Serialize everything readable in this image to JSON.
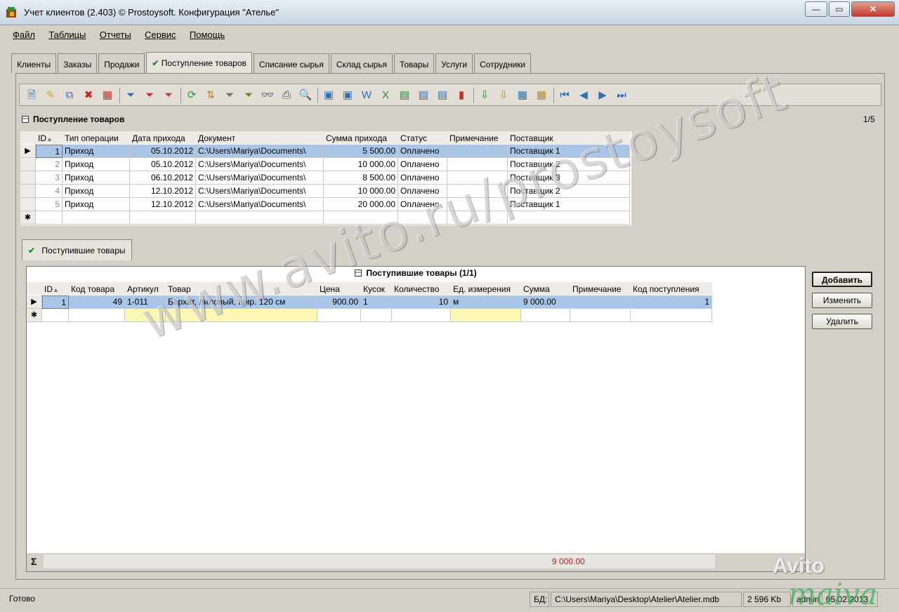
{
  "window": {
    "title": "Учет клиентов (2.403) © Prostoysoft. Конфигурация \"Ателье\"",
    "btn_min": "—",
    "btn_max": "▭",
    "btn_close": "✕"
  },
  "menu": [
    "Файл",
    "Таблицы",
    "Отчеты",
    "Сервис",
    "Помощь"
  ],
  "tabs": [
    "Клиенты",
    "Заказы",
    "Продажи",
    "Поступление товаров",
    "Списание сырья",
    "Склад сырья",
    "Товары",
    "Услуги",
    "Сотрудники"
  ],
  "active_tab": "Поступление товаров",
  "check_glyph": "✔",
  "toolbar_icons": [
    {
      "name": "new-record-icon",
      "glyph": "🗎",
      "color": "#2f6fb5"
    },
    {
      "name": "edit-pencil-icon",
      "glyph": "✎",
      "color": "#e0a020"
    },
    {
      "name": "copy-record-icon",
      "glyph": "⧉",
      "color": "#2f6fb5"
    },
    {
      "name": "delete-icon",
      "glyph": "✖",
      "color": "#d02020"
    },
    {
      "name": "delete-table-icon",
      "glyph": "▦",
      "color": "#c03030"
    },
    {
      "name": "filter-icon",
      "glyph": "⏷",
      "color": "#2f6fb5"
    },
    {
      "name": "filter-remove-icon",
      "glyph": "⏷",
      "color": "#d03030"
    },
    {
      "name": "filter-clear-icon",
      "glyph": "⏷",
      "color": "#c04040"
    },
    {
      "name": "refresh-icon",
      "glyph": "⟳",
      "color": "#2a9a3a"
    },
    {
      "name": "sort-icon",
      "glyph": "⇅",
      "color": "#b08a20"
    },
    {
      "name": "advanced-filter-icon",
      "glyph": "⏷",
      "color": "#707070"
    },
    {
      "name": "sql-icon",
      "glyph": "⏷",
      "color": "#6a8a20"
    },
    {
      "name": "find-binoculars-icon",
      "glyph": "👓",
      "color": "#202020"
    },
    {
      "name": "print-icon",
      "glyph": "⎙",
      "color": "#404040"
    },
    {
      "name": "print-preview-icon",
      "glyph": "🔍",
      "color": "#2f6fb5"
    },
    {
      "name": "export-icon",
      "glyph": "▣",
      "color": "#2f6fb5"
    },
    {
      "name": "export-2-icon",
      "glyph": "▣",
      "color": "#2f6fb5"
    },
    {
      "name": "export-word-icon",
      "glyph": "W",
      "color": "#2f6fb5"
    },
    {
      "name": "export-excel-icon",
      "glyph": "X",
      "color": "#2a8a2a"
    },
    {
      "name": "export-calc-icon",
      "glyph": "▤",
      "color": "#2a8a2a"
    },
    {
      "name": "export-html-icon",
      "glyph": "▤",
      "color": "#2f6fb5"
    },
    {
      "name": "export-xml-icon",
      "glyph": "▤",
      "color": "#2f6fb5"
    },
    {
      "name": "chart-icon",
      "glyph": "▮",
      "color": "#c03030"
    },
    {
      "name": "import-icon",
      "glyph": "⇩",
      "color": "#2a8a2a"
    },
    {
      "name": "attach-icon",
      "glyph": "⇩",
      "color": "#b08a20"
    },
    {
      "name": "columns-icon",
      "glyph": "▦",
      "color": "#2f6fb5"
    },
    {
      "name": "settings-grid-icon",
      "glyph": "▦",
      "color": "#b08a20"
    },
    {
      "name": "first-record-icon",
      "glyph": "⏮",
      "color": "#2f6fb5"
    },
    {
      "name": "prev-record-icon",
      "glyph": "◀",
      "color": "#2f6fb5"
    },
    {
      "name": "next-record-icon",
      "glyph": "▶",
      "color": "#2f6fb5"
    },
    {
      "name": "last-record-icon",
      "glyph": "⏭",
      "color": "#2f6fb5"
    }
  ],
  "main_section": {
    "title": "Поступление товаров",
    "count": "1/5",
    "columns": [
      "ID",
      "Тип операции",
      "Дата прихода",
      "Документ",
      "Сумма прихода",
      "Статус",
      "Примечание",
      "Поставщик"
    ],
    "sort_mark": "▲",
    "rows": [
      {
        "id": "1",
        "type": "Приход",
        "date": "05.10.2012",
        "doc": "C:\\Users\\Mariya\\Documents\\",
        "sum": "5 500.00",
        "status": "Оплачено",
        "note": "",
        "supplier": "Поставщик 1"
      },
      {
        "id": "2",
        "type": "Приход",
        "date": "05.10.2012",
        "doc": "C:\\Users\\Mariya\\Documents\\",
        "sum": "10 000.00",
        "status": "Оплачено",
        "note": "",
        "supplier": "Поставщик 2"
      },
      {
        "id": "3",
        "type": "Приход",
        "date": "06.10.2012",
        "doc": "C:\\Users\\Mariya\\Documents\\",
        "sum": "8 500.00",
        "status": "Оплачено",
        "note": "",
        "supplier": "Поставщик 3"
      },
      {
        "id": "4",
        "type": "Приход",
        "date": "12.10.2012",
        "doc": "C:\\Users\\Mariya\\Documents\\",
        "sum": "10 000.00",
        "status": "Оплачено",
        "note": "",
        "supplier": "Поставщик 2"
      },
      {
        "id": "5",
        "type": "Приход",
        "date": "12.10.2012",
        "doc": "C:\\Users\\Mariya\\Documents\\",
        "sum": "20 000.00",
        "status": "Оплачено",
        "note": "",
        "supplier": "Поставщик 1"
      }
    ]
  },
  "sub_tab": "Поступившие товары",
  "detail": {
    "title": "Поступившие товары (1/1)",
    "columns": [
      "ID",
      "Код товара",
      "Артикул",
      "Товар",
      "Цена",
      "Кусок",
      "Количество",
      "Ед. измерения",
      "Сумма",
      "Примечание",
      "Код поступления"
    ],
    "rows": [
      {
        "id": "1",
        "code": "49",
        "article": "1-011",
        "product": "Бархат, лиловый, шир. 120 см",
        "price": "900.00",
        "piece": "1",
        "qty": "10",
        "unit": "м",
        "sum": "9 000.00",
        "note": "",
        "receipt_code": "1"
      }
    ],
    "total": "9 000.00",
    "sigma": "Σ"
  },
  "buttons": {
    "add": "Добавить",
    "edit": "Изменить",
    "delete": "Удалить"
  },
  "row_marks": {
    "current": "▶",
    "new": "✱"
  },
  "status": {
    "text": "Готово",
    "db_label": "БД:",
    "db_path": "C:\\Users\\Mariya\\Desktop\\Atelier\\Atelier.mdb",
    "memory": "2 596 Kb",
    "user": "admin",
    "date": "05.02.2013"
  },
  "watermark": "www.avito.ru/prostoysoft",
  "avito_logo": "Avito",
  "maiva_logo": "maiva"
}
